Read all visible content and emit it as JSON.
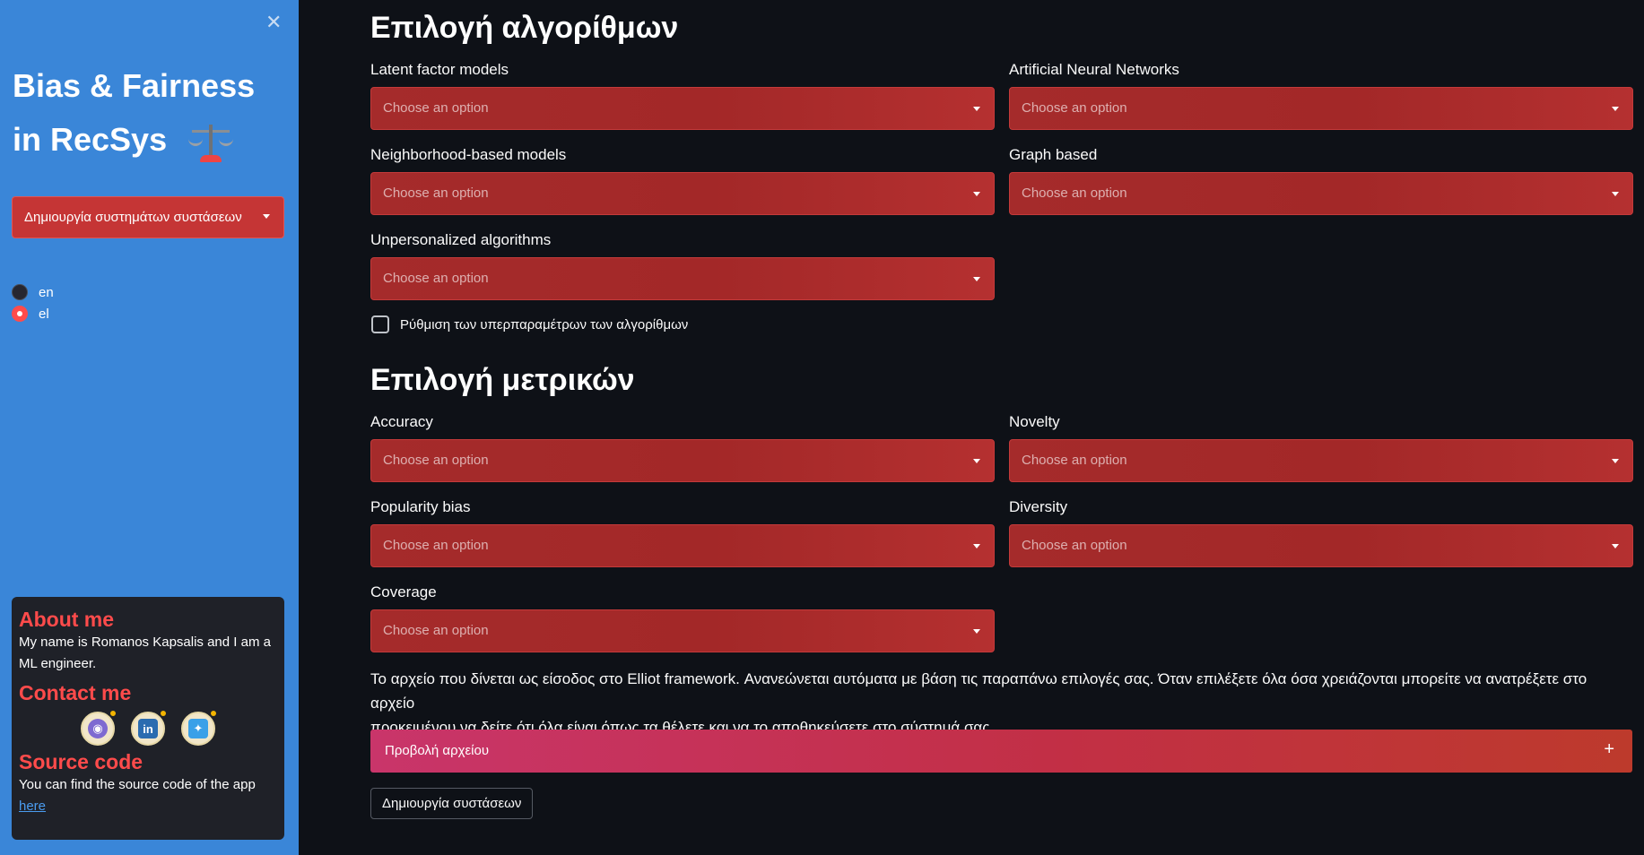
{
  "sidebar": {
    "title_line1": "Bias & Fairness",
    "title_line2": "in RecSys",
    "page_select_value": "Δημιουργία συστημάτων συστάσεων",
    "language_options": [
      "en",
      "el"
    ],
    "language_selected": "el",
    "about": {
      "heading": "About me",
      "text": "My name is Romanos Kapsalis and I am a ML engineer.",
      "contact_heading": "Contact me",
      "social": [
        "github-icon",
        "linkedin-icon",
        "twitter-icon"
      ],
      "source_heading": "Source code",
      "source_text": "You can find the source code of the app",
      "source_link": "here"
    }
  },
  "main": {
    "algorithms": {
      "title": "Επιλογή αλγορίθμων",
      "fields": [
        {
          "label": "Latent factor models",
          "placeholder": "Choose an option"
        },
        {
          "label": "Artificial Neural Networks",
          "placeholder": "Choose an option"
        },
        {
          "label": "Neighborhood-based models",
          "placeholder": "Choose an option"
        },
        {
          "label": "Graph based",
          "placeholder": "Choose an option"
        },
        {
          "label": "Unpersonalized algorithms",
          "placeholder": "Choose an option"
        }
      ],
      "hyperparams_checkbox": "Ρύθμιση των υπερπαραμέτρων των αλγορίθμων"
    },
    "metrics": {
      "title": "Επιλογή μετρικών",
      "fields": [
        {
          "label": "Accuracy",
          "placeholder": "Choose an option"
        },
        {
          "label": "Novelty",
          "placeholder": "Choose an option"
        },
        {
          "label": "Popularity bias",
          "placeholder": "Choose an option"
        },
        {
          "label": "Diversity",
          "placeholder": "Choose an option"
        },
        {
          "label": "Coverage",
          "placeholder": "Choose an option"
        }
      ]
    },
    "description_line1": "Το αρχείο που δίνεται ως είσοδος στο Elliot framework. Ανανεώνεται αυτόματα με βάση τις παραπάνω επιλογές σας. Όταν επιλέξετε όλα όσα χρειάζονται μπορείτε να ανατρέξετε στο αρχείο",
    "description_line2": "προκειμένου να δείτε ότι όλα είναι όπως τα θέλετε και να το αποθηκεύσετε στο σύστημά σας.",
    "expander_label": "Προβολή αρχείου",
    "expander_icon": "+",
    "create_button": "Δημιουργία συστάσεων"
  },
  "colors": {
    "sidebar_bg": "#3a86d8",
    "main_bg": "#0e1117",
    "accent_red": "#ff4b4b",
    "select_bg": "#a52b2b"
  }
}
